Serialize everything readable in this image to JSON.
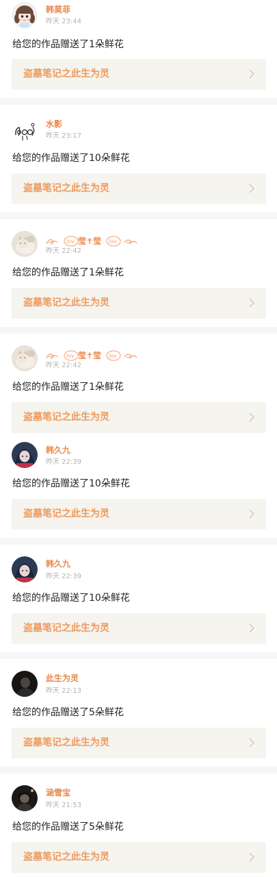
{
  "notifications": [
    {
      "user": "韩莫菲",
      "time": "昨天 23:44",
      "message": "给您的作品赠送了1朵鲜花",
      "work_title": "盗墓笔记之此生为灵",
      "avatar_icon": "cartoon-girl-avatar"
    },
    {
      "user": "水影",
      "time": "昨天 23:17",
      "message": "给您的作品赠送了10朵鲜花",
      "work_title": "盗墓笔记之此生为灵",
      "avatar_icon": "doodle-avatar"
    },
    {
      "user": "莹✝莹",
      "time": "昨天 22:42",
      "message": "给您的作品赠送了1朵鲜花",
      "work_title": "盗墓笔记之此生为灵",
      "avatar_icon": "cat-photo-avatar"
    },
    {
      "user": "莹✝莹",
      "time": "昨天 22:42",
      "message": "给您的作品赠送了1朵鲜花",
      "work_title": "盗墓笔记之此生为灵",
      "avatar_icon": "cat-photo-avatar"
    },
    {
      "user": "韩久九",
      "time": "昨天 22:39",
      "message": "给您的作品赠送了10朵鲜花",
      "work_title": "盗墓笔记之此生为灵",
      "avatar_icon": "anime-character-avatar"
    },
    {
      "user": "韩久九",
      "time": "昨天 22:39",
      "message": "给您的作品赠送了10朵鲜花",
      "work_title": "盗墓笔记之此生为灵",
      "avatar_icon": "anime-character-avatar"
    },
    {
      "user": "此生为灵",
      "time": "昨天 22:13",
      "message": "给您的作品赠送了5朵鲜花",
      "work_title": "盗墓笔记之此生为灵",
      "avatar_icon": "dark-portrait-avatar"
    },
    {
      "user": "涵雪宝",
      "time": "昨天 21:53",
      "message": "给您的作品赠送了5朵鲜花",
      "work_title": "盗墓笔记之此生为灵",
      "avatar_icon": "dark-portrait-avatar"
    }
  ],
  "colors": {
    "username": "#e8894f",
    "work_title": "#ee9a5f",
    "work_link_bg": "#f5f4ee",
    "divider": "#f6f6f6",
    "time": "#b3b3b3",
    "message": "#222222"
  }
}
